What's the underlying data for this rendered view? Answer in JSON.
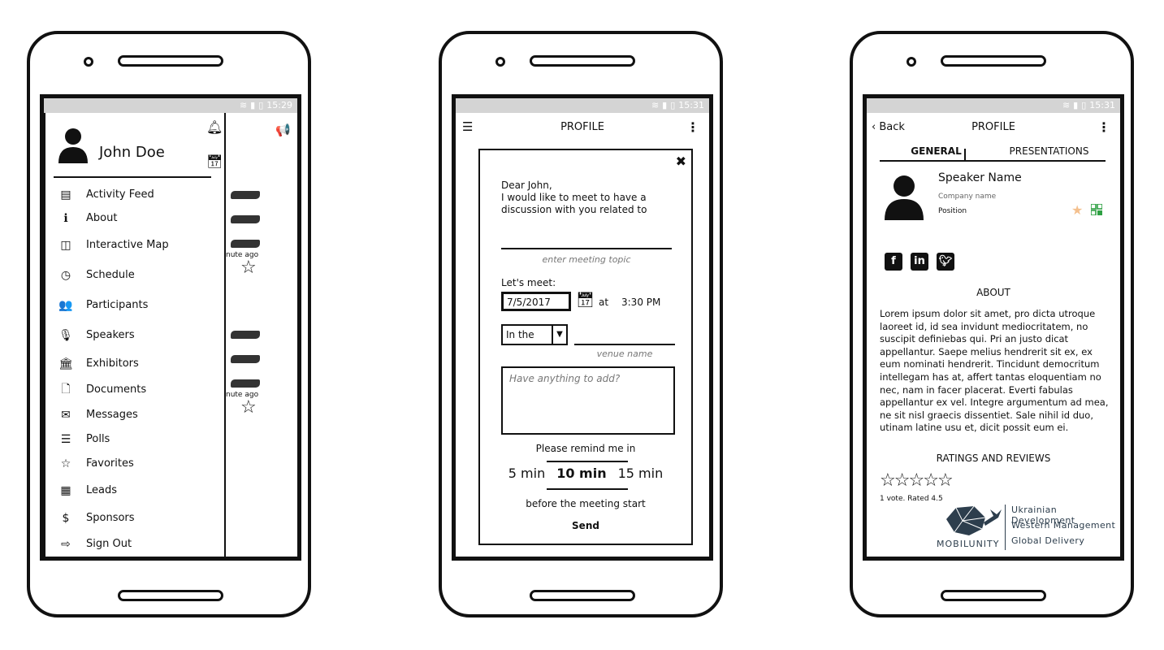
{
  "phone1": {
    "status": {
      "time": "15:29"
    },
    "drawer": {
      "user_name": "John Doe",
      "menu": [
        {
          "icon": "newspaper-icon",
          "glyph": "▤",
          "label": "Activity Feed"
        },
        {
          "icon": "info-icon",
          "glyph": "ℹ",
          "label": "About"
        },
        {
          "icon": "map-icon",
          "glyph": "◫",
          "label": "Interactive Map"
        },
        {
          "icon": "clock-icon",
          "glyph": "◷",
          "label": "Schedule"
        },
        {
          "icon": "users-icon",
          "glyph": "👥",
          "label": "Participants"
        },
        {
          "icon": "microphone-icon",
          "glyph": "🎙",
          "label": "Speakers"
        },
        {
          "icon": "bank-icon",
          "glyph": "🏛",
          "label": "Exhibitors"
        },
        {
          "icon": "document-icon",
          "glyph": "🗋",
          "label": "Documents"
        },
        {
          "icon": "envelope-icon",
          "glyph": "✉",
          "label": "Messages"
        },
        {
          "icon": "list-icon",
          "glyph": "☰",
          "label": "Polls"
        },
        {
          "icon": "star-icon",
          "glyph": "☆",
          "label": "Favorites"
        },
        {
          "icon": "qr-code-icon",
          "glyph": "▦",
          "label": "Leads"
        },
        {
          "icon": "dollar-icon",
          "glyph": "$",
          "label": "Sponsors"
        },
        {
          "icon": "sign-out-icon",
          "glyph": "⇨",
          "label": "Sign Out"
        }
      ]
    },
    "feed": {
      "ago_text": "nute ago"
    }
  },
  "phone2": {
    "status": {
      "time": "15:31"
    },
    "appbar": {
      "title": "PROFILE"
    },
    "dialog": {
      "greeting_line1": "Dear John,",
      "greeting_line2": "I would like to meet to have a discussion with you related to",
      "topic_placeholder": "enter meeting topic",
      "lets_meet_label": "Let's meet:",
      "date_value": "7/5/2017",
      "at_label": "at",
      "time_value": "3:30 PM",
      "venue_prefix_selected": "In the",
      "venue_placeholder": "venue name",
      "notes_placeholder": "Have anything to add?",
      "remind_label": "Please remind me in",
      "remind_options": [
        "5 min",
        "10 min",
        "15 min"
      ],
      "remind_selected": "10 min",
      "before_label": "before the meeting start",
      "send_label": "Send"
    }
  },
  "phone3": {
    "status": {
      "time": "15:31"
    },
    "appbar": {
      "back_label": "Back",
      "title": "PROFILE"
    },
    "tabs": [
      {
        "label": "GENERAL",
        "active": true
      },
      {
        "label": "PRESENTATIONS",
        "active": false
      }
    ],
    "profile": {
      "name": "Speaker Name",
      "company": "Company name",
      "position": "Position",
      "favorite_color": "#f4c08e",
      "qr_color": "#2ea043"
    },
    "social": [
      "facebook",
      "linkedin",
      "twitter"
    ],
    "about_heading": "ABOUT",
    "about_text": "Lorem ipsum dolor sit amet, pro dicta utroque laoreet id, id sea invidunt mediocritatem, no suscipit definiebas qui. Pri an justo dicat appellantur. Saepe melius hendrerit sit ex, ex eum nominati hendrerit. Tincidunt democritum intellegam has at, affert tantas eloquentiam no nec, nam in facer placerat. Everti fabulas appellantur ex vel. Integre argumentum ad mea, ne sit nisl graecis dissentiet. Sale nihil id duo, utinam latine usu et, dicit possit eum ei.",
    "ratings_heading": "RATINGS AND REVIEWS",
    "rating": {
      "value": 4.5,
      "max": 5,
      "votes_text": "1 vote. Rated 4.5"
    },
    "brand": {
      "name": "MOBILUNITY",
      "taglines": [
        "Ukrainian Development",
        "Western Management",
        "Global Delivery"
      ],
      "color": "#2d3e4d"
    }
  }
}
